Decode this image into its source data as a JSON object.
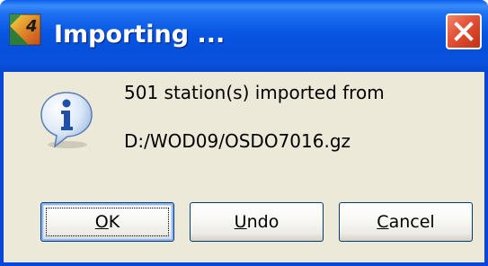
{
  "window": {
    "title": "Importing ...",
    "app_icon": "ocean-data-view-icon",
    "close_icon": "close-icon"
  },
  "message": {
    "icon": "info-icon",
    "line1": "501 station(s) imported from",
    "line2": "D:/WOD09/OSDO7016.gz"
  },
  "buttons": {
    "ok": {
      "mnemonic": "O",
      "rest": "K"
    },
    "undo": {
      "mnemonic": "U",
      "rest": "ndo"
    },
    "cancel": {
      "mnemonic": "C",
      "rest": "ancel"
    }
  },
  "colors": {
    "titlebar": "#0A54E0",
    "frame": "#0A46D9",
    "dialog_bg": "#ECE9D8",
    "close_button": "#E4563A"
  }
}
